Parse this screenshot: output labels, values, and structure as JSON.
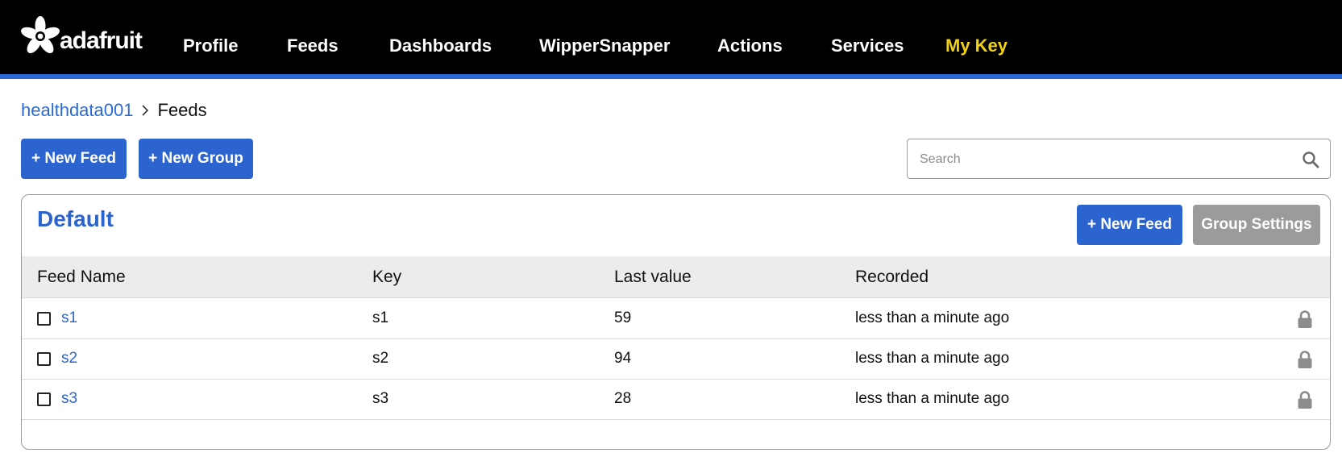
{
  "brand": {
    "name": "adafruit",
    "logo_icon": "adafruit-flower-icon"
  },
  "nav": {
    "items": [
      {
        "label": "Profile"
      },
      {
        "label": "Feeds"
      },
      {
        "label": "Dashboards"
      },
      {
        "label": "WipperSnapper"
      },
      {
        "label": "Actions"
      },
      {
        "label": "Services"
      },
      {
        "label": "My Key"
      }
    ]
  },
  "colors": {
    "accent": "#2b63cf",
    "topbar": "#000000",
    "my_key": "#f2d013",
    "secondary_button": "#9b9b9b"
  },
  "breadcrumb": {
    "user": "healthdata001",
    "current": "Feeds"
  },
  "toolbar": {
    "new_feed_label": "+ New Feed",
    "new_group_label": "+ New Group"
  },
  "search": {
    "placeholder": "Search",
    "value": "",
    "icon": "search-icon"
  },
  "group": {
    "title": "Default",
    "new_feed_label": "+ New Feed",
    "settings_label": "Group Settings",
    "columns": [
      "Feed Name",
      "Key",
      "Last value",
      "Recorded"
    ],
    "rows": [
      {
        "name": "s1",
        "key": "s1",
        "last_value": "59",
        "recorded": "less than a minute ago",
        "checked": false,
        "icon": "lock-icon"
      },
      {
        "name": "s2",
        "key": "s2",
        "last_value": "94",
        "recorded": "less than a minute ago",
        "checked": false,
        "icon": "lock-icon"
      },
      {
        "name": "s3",
        "key": "s3",
        "last_value": "28",
        "recorded": "less than a minute ago",
        "checked": false,
        "icon": "lock-icon"
      }
    ]
  }
}
